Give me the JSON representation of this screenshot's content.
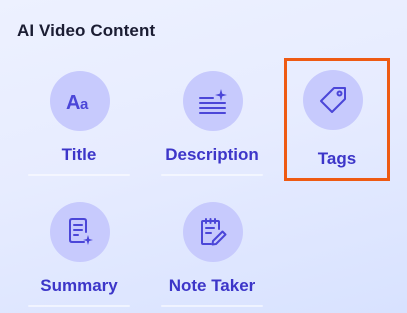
{
  "section": {
    "title": "AI Video Content"
  },
  "tools": [
    {
      "label": "Title",
      "icon": "font-size-icon",
      "selected": false
    },
    {
      "label": "Description",
      "icon": "text-lines-sparkle-icon",
      "selected": false
    },
    {
      "label": "Tags",
      "icon": "tag-icon",
      "selected": true
    },
    {
      "label": "Summary",
      "icon": "document-sparkle-icon",
      "selected": false
    },
    {
      "label": "Note Taker",
      "icon": "notepad-pen-icon",
      "selected": false
    }
  ],
  "colors": {
    "icon_circle": "#c7cafd",
    "icon_stroke": "#4b46d8",
    "label": "#3d36c9",
    "selection_outline": "#ee5a13"
  }
}
